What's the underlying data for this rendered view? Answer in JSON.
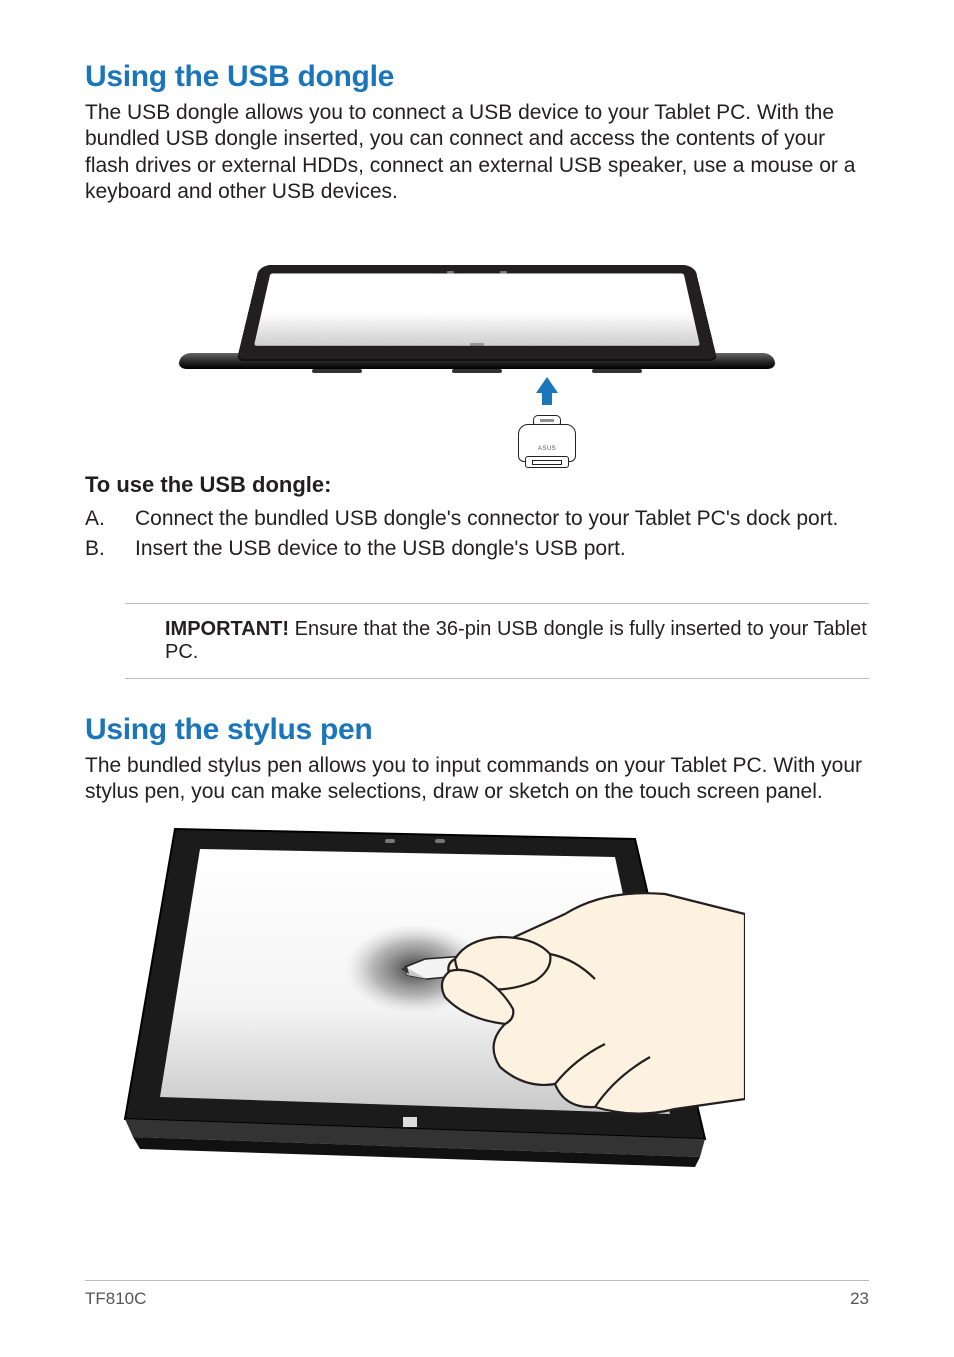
{
  "section1": {
    "heading": "Using the USB dongle",
    "intro": "The USB dongle allows you to connect a USB device to your Tablet PC. With the bundled USB dongle inserted, you can connect and access the contents of your flash drives or external HDDs, connect an external USB speaker, use a mouse or a keyboard and other USB devices.",
    "sub_heading": "To use the USB dongle:",
    "steps": [
      {
        "label": "A.",
        "text": "Connect the bundled USB dongle's connector to your Tablet PC's dock port."
      },
      {
        "label": "B.",
        "text": "Insert the USB device to the USB dongle's USB port."
      }
    ],
    "note": {
      "label": "IMPORTANT! ",
      "text": " Ensure that the 36-pin USB dongle is fully inserted to your Tablet PC."
    },
    "dongle_logo": "ASUS"
  },
  "section2": {
    "heading": "Using the stylus pen",
    "intro": "The bundled stylus pen allows you to input commands on your Tablet PC. With your stylus pen, you can make selections, draw or sketch on the touch screen panel."
  },
  "footer": {
    "model": "TF810C",
    "page": "23"
  }
}
